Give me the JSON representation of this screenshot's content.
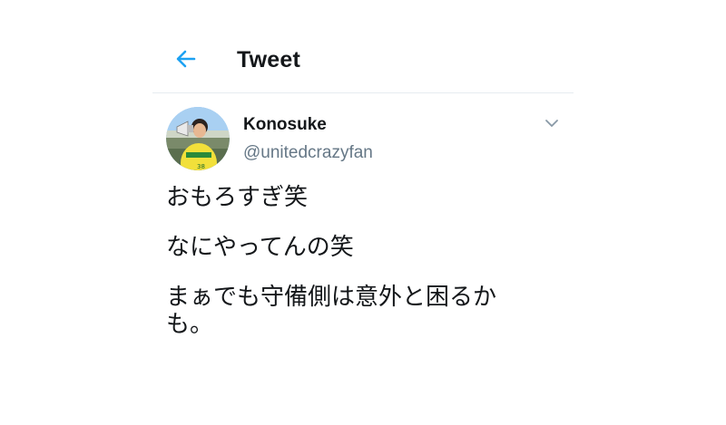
{
  "header": {
    "title": "Tweet",
    "back_icon": "arrow-left-icon",
    "accent_color": "#1da1f2"
  },
  "tweet": {
    "author": {
      "display_name": "Konosuke",
      "handle": "@unitedcrazyfan",
      "avatar_icon": "avatar-photo"
    },
    "menu_icon": "chevron-down-icon",
    "lines": [
      "おもろすぎ笑",
      "なにやってんの笑",
      "まぁでも守備側は意外と困るか",
      "も。"
    ]
  },
  "colors": {
    "text_primary": "#14171a",
    "text_secondary": "#657786",
    "divider": "#e6ecf0"
  }
}
